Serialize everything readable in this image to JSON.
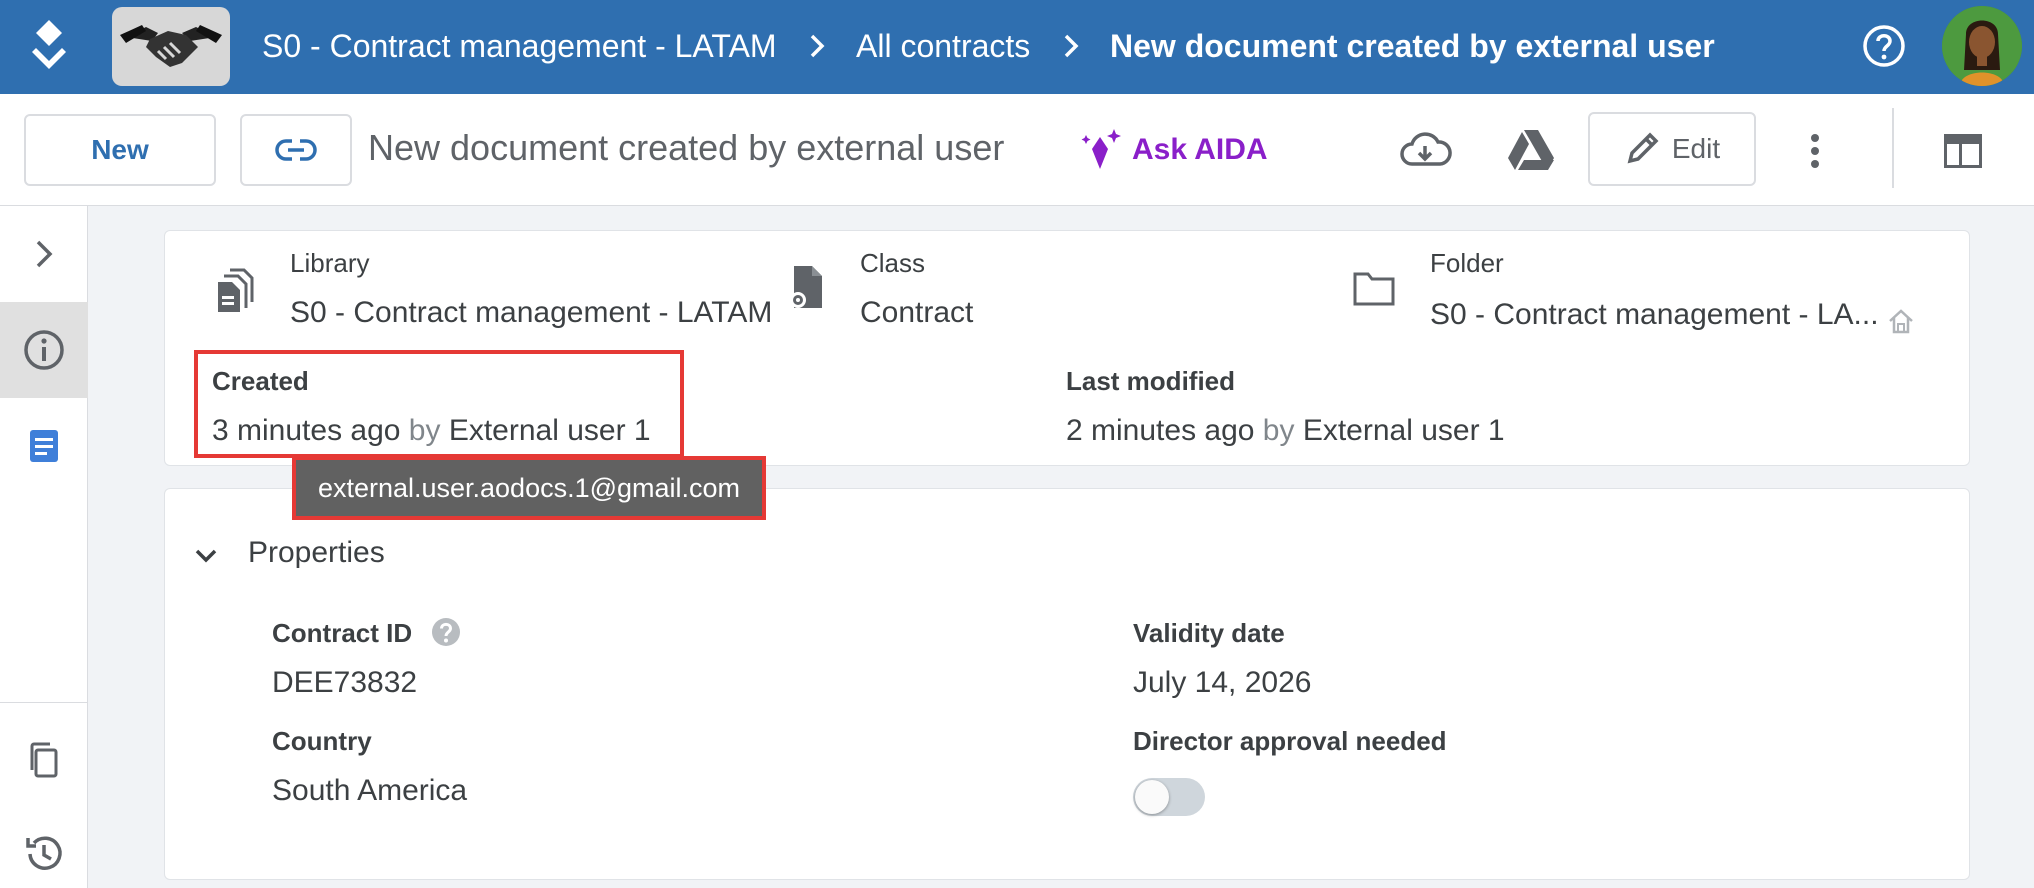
{
  "header": {
    "breadcrumb": [
      "S0 - Contract management - LATAM",
      "All contracts",
      "New document created by external user"
    ],
    "logo_icon": "aodocs-stack-icon",
    "library_logo_icon": "handshake-icon"
  },
  "toolbar": {
    "new_label": "New",
    "doc_title": "New document created by external user",
    "aida_label": "Ask AIDA",
    "edit_label": "Edit"
  },
  "info": {
    "library_label": "Library",
    "library_value": "S0 - Contract management - LATAM",
    "class_label": "Class",
    "class_value": "Contract",
    "folder_label": "Folder",
    "folder_value": "S0 - Contract management - LA...",
    "created_label": "Created",
    "created_when": "3 minutes ago",
    "created_by_word": "by",
    "created_by": "External user 1",
    "modified_label": "Last modified",
    "modified_when": "2 minutes ago",
    "modified_by_word": "by",
    "modified_by": "External user 1",
    "tooltip": "external.user.aodocs.1@gmail.com"
  },
  "properties": {
    "section_title": "Properties",
    "contract_id_label": "Contract ID",
    "contract_id_value": "DEE73832",
    "validity_label": "Validity date",
    "validity_value": "July 14, 2026",
    "country_label": "Country",
    "country_value": "South America",
    "director_label": "Director approval needed",
    "director_value": false
  },
  "colors": {
    "header_bg": "#2f6fb0",
    "aida": "#8a1fc9",
    "highlight": "#e53935",
    "tooltip_bg": "#616161"
  }
}
